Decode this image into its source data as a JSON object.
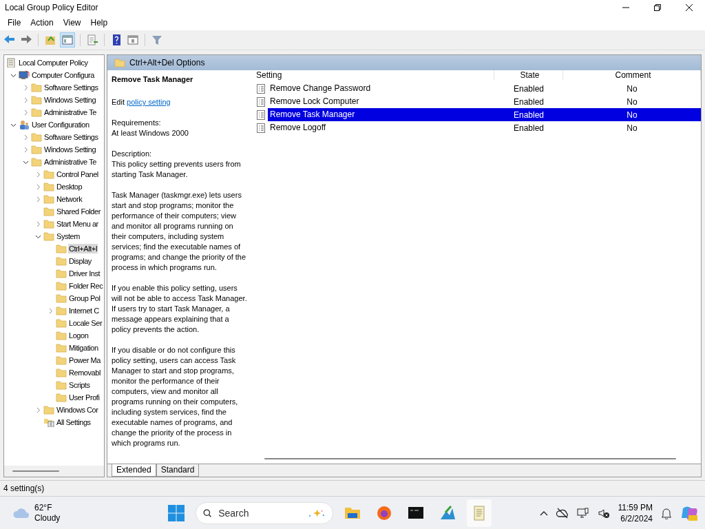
{
  "window": {
    "title": "Local Group Policy Editor"
  },
  "menu": [
    "File",
    "Action",
    "View",
    "Help"
  ],
  "tree": [
    {
      "label": "Local Computer Policy",
      "kind": "policy",
      "selected": false,
      "children": [
        {
          "label": "Computer Configura",
          "kind": "computer",
          "expanded": true,
          "selected": false,
          "children": [
            {
              "label": "Software Settings",
              "kind": "folder",
              "expanded": false,
              "selected": false
            },
            {
              "label": "Windows Setting",
              "kind": "folder",
              "expanded": false,
              "selected": false
            },
            {
              "label": "Administrative Te",
              "kind": "folder",
              "expanded": false,
              "selected": false
            }
          ]
        },
        {
          "label": "User Configuration",
          "kind": "user",
          "expanded": true,
          "selected": false,
          "children": [
            {
              "label": "Software Settings",
              "kind": "folder",
              "expanded": false,
              "selected": false
            },
            {
              "label": "Windows Setting",
              "kind": "folder",
              "expanded": false,
              "selected": false
            },
            {
              "label": "Administrative Te",
              "kind": "folder",
              "expanded": true,
              "selected": false,
              "children": [
                {
                  "label": "Control Panel",
                  "kind": "folder",
                  "expanded": false,
                  "selected": false
                },
                {
                  "label": "Desktop",
                  "kind": "folder",
                  "expanded": false,
                  "selected": false
                },
                {
                  "label": "Network",
                  "kind": "folder",
                  "expanded": false,
                  "selected": false
                },
                {
                  "label": "Shared Folder",
                  "kind": "folder",
                  "selected": false
                },
                {
                  "label": "Start Menu ar",
                  "kind": "folder",
                  "expanded": false,
                  "selected": false
                },
                {
                  "label": "System",
                  "kind": "folder",
                  "expanded": true,
                  "selected": false,
                  "children": [
                    {
                      "label": "Ctrl+Alt+I",
                      "kind": "folder",
                      "selected": true
                    },
                    {
                      "label": "Display",
                      "kind": "folder",
                      "selected": false
                    },
                    {
                      "label": "Driver Inst",
                      "kind": "folder",
                      "selected": false
                    },
                    {
                      "label": "Folder Rec",
                      "kind": "folder",
                      "selected": false
                    },
                    {
                      "label": "Group Pol",
                      "kind": "folder",
                      "selected": false
                    },
                    {
                      "label": "Internet C",
                      "kind": "folder",
                      "expanded": false,
                      "selected": false
                    },
                    {
                      "label": "Locale Ser",
                      "kind": "folder",
                      "selected": false
                    },
                    {
                      "label": "Logon",
                      "kind": "folder",
                      "selected": false
                    },
                    {
                      "label": "Mitigation",
                      "kind": "folder",
                      "selected": false
                    },
                    {
                      "label": "Power Ma",
                      "kind": "folder",
                      "selected": false
                    },
                    {
                      "label": "Removabl",
                      "kind": "folder",
                      "selected": false
                    },
                    {
                      "label": "Scripts",
                      "kind": "folder",
                      "selected": false
                    },
                    {
                      "label": "User Profi",
                      "kind": "folder",
                      "selected": false
                    }
                  ]
                },
                {
                  "label": "Windows Cor",
                  "kind": "folder",
                  "expanded": false,
                  "selected": false
                },
                {
                  "label": "All Settings",
                  "kind": "settings",
                  "selected": false
                }
              ]
            }
          ]
        }
      ]
    }
  ],
  "pane_header": "Ctrl+Alt+Del Options",
  "detail": {
    "title": "Remove Task Manager",
    "edit_prefix": "Edit",
    "edit_link": "policy setting",
    "requirements_label": "Requirements:",
    "requirements": "At least Windows 2000",
    "description_label": "Description:",
    "paragraphs": [
      "This policy setting prevents users from starting Task Manager.",
      "Task Manager (taskmgr.exe) lets users start and stop programs; monitor the performance of their computers; view and monitor all programs running on their computers, including system services; find the executable names of programs; and change the priority of the process in which programs run.",
      "If you enable this policy setting, users will not be able to access Task Manager. If users try to start Task Manager, a message appears explaining that a policy prevents the action.",
      "If you disable or do not configure this policy setting, users can access Task Manager to  start and stop programs, monitor the performance of their computers, view and monitor all programs running on their computers, including system services, find the executable names of programs, and change the priority of the process in which programs run."
    ]
  },
  "table": {
    "columns": [
      "Setting",
      "State",
      "Comment"
    ],
    "rows": [
      {
        "setting": "Remove Change Password",
        "state": "Enabled",
        "comment": "No",
        "selected": false
      },
      {
        "setting": "Remove Lock Computer",
        "state": "Enabled",
        "comment": "No",
        "selected": false
      },
      {
        "setting": "Remove Task Manager",
        "state": "Enabled",
        "comment": "No",
        "selected": true
      },
      {
        "setting": "Remove Logoff",
        "state": "Enabled",
        "comment": "No",
        "selected": false
      }
    ]
  },
  "tabs": [
    {
      "label": "Extended",
      "selected": true
    },
    {
      "label": "Standard",
      "selected": false
    }
  ],
  "status_bar": "4 setting(s)",
  "taskbar": {
    "temperature": "62°F",
    "condition": "Cloudy",
    "search_placeholder": "Search",
    "time": "11:59 PM",
    "date": "6/2/2024"
  }
}
